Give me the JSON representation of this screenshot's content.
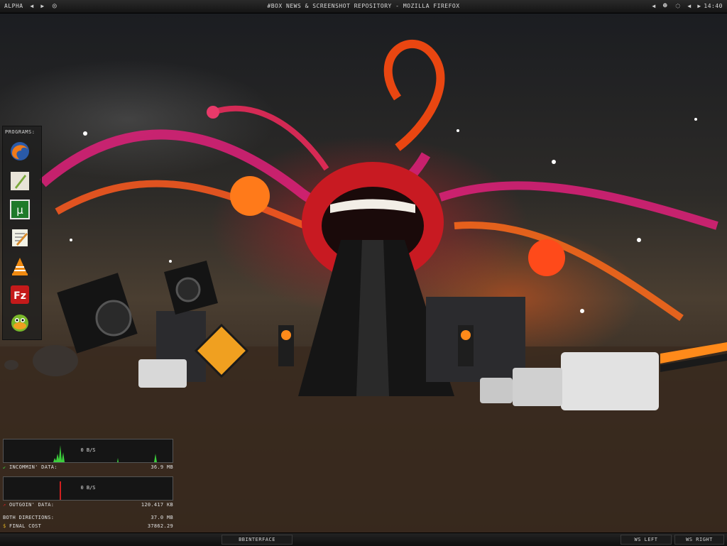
{
  "topbar": {
    "workspace": "ALPHA",
    "window_title": "#BOX NEWS & SCREENSHOT REPOSITORY - MOZILLA FIREFOX",
    "clock": "14:40",
    "prev_icon": "arrow-left-icon",
    "next_icon": "arrow-right-icon",
    "tray_icons": [
      "user-icon",
      "network-icon"
    ]
  },
  "dock": {
    "label": "PROGRAMS:",
    "items": [
      {
        "name": "firefox",
        "icon": "firefox-icon"
      },
      {
        "name": "text-editor",
        "icon": "quill-icon"
      },
      {
        "name": "utorrent",
        "icon": "utorrent-icon"
      },
      {
        "name": "notepad",
        "icon": "notepad-icon"
      },
      {
        "name": "vlc",
        "icon": "vlc-icon"
      },
      {
        "name": "filezilla",
        "icon": "filezilla-icon"
      },
      {
        "name": "messenger",
        "icon": "duck-icon"
      }
    ]
  },
  "network": {
    "incoming_rate": "0 B/S",
    "incoming_label": "INCOMMIN' DATA:",
    "incoming_total": "36.9 MB",
    "outgoing_rate": "0 B/S",
    "outgoing_label": "OUTGOIN' DATA:",
    "outgoing_total": "120.417 KB",
    "both_label": "BOTH DIRECTIONS:",
    "both_total": "37.0 MB",
    "cost_label": "FINAL COST",
    "cost_value": "37862.29"
  },
  "bottombar": {
    "toolbar_label": "BBINTERFACE",
    "ws_left": "WS LEFT",
    "ws_right": "WS RIGHT"
  },
  "colors": {
    "accent_red": "#d4202a",
    "accent_orange": "#ff6a1a",
    "graph_green": "#3ccf3c",
    "graph_red": "#d02020"
  }
}
